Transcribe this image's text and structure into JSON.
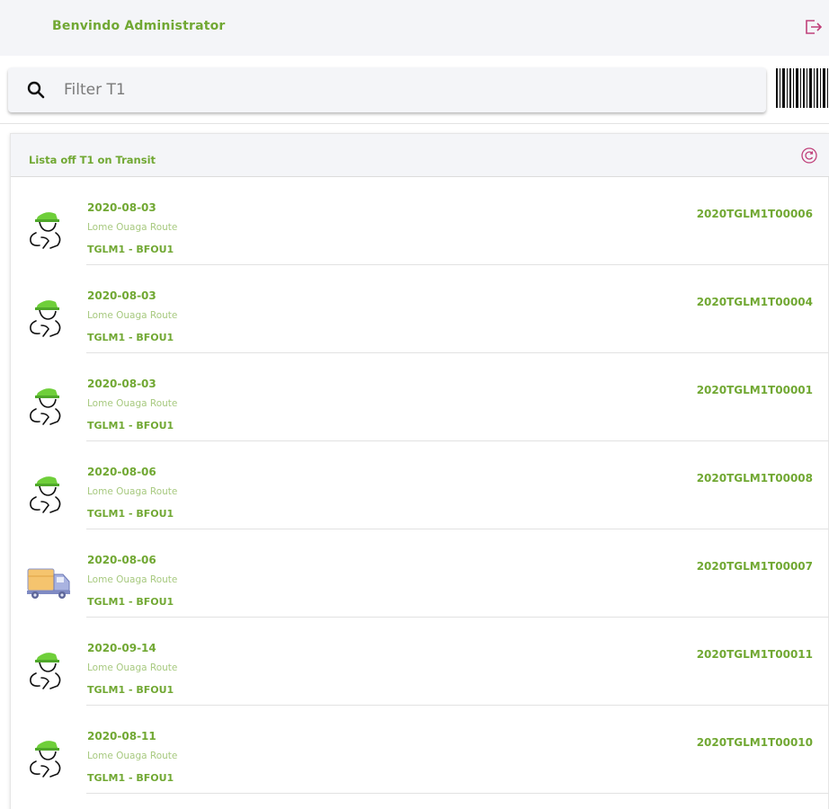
{
  "header": {
    "welcome": "Benvindo Administrator",
    "logout_icon": "logout-icon"
  },
  "search": {
    "placeholder": "Filter T1",
    "value": "",
    "icon": "search-icon",
    "scanner_icon": "barcode-icon"
  },
  "list": {
    "title": "Lista off T1 on Transit",
    "refresh_icon": "refresh-icon",
    "items": [
      {
        "date": "2020-08-03",
        "route": "Lome Ouaga Route",
        "code": "TGLM1 - BFOU1",
        "ref": "2020TGLM1T00006",
        "icon": "driver-icon"
      },
      {
        "date": "2020-08-03",
        "route": "Lome Ouaga Route",
        "code": "TGLM1 - BFOU1",
        "ref": "2020TGLM1T00004",
        "icon": "driver-icon"
      },
      {
        "date": "2020-08-03",
        "route": "Lome Ouaga Route",
        "code": "TGLM1 - BFOU1",
        "ref": "2020TGLM1T00001",
        "icon": "driver-icon"
      },
      {
        "date": "2020-08-06",
        "route": "Lome Ouaga Route",
        "code": "TGLM1 - BFOU1",
        "ref": "2020TGLM1T00008",
        "icon": "driver-icon"
      },
      {
        "date": "2020-08-06",
        "route": "Lome Ouaga Route",
        "code": "TGLM1 - BFOU1",
        "ref": "2020TGLM1T00007",
        "icon": "truck-icon"
      },
      {
        "date": "2020-09-14",
        "route": "Lome Ouaga Route",
        "code": "TGLM1 - BFOU1",
        "ref": "2020TGLM1T00011",
        "icon": "driver-icon"
      },
      {
        "date": "2020-08-11",
        "route": "Lome Ouaga Route",
        "code": "TGLM1 - BFOU1",
        "ref": "2020TGLM1T00010",
        "icon": "driver-icon"
      }
    ]
  },
  "colors": {
    "accent": "#71a833",
    "accent_light": "#a7c97f",
    "header_bg": "#f4f5f8",
    "icon_pink": "#c0407a"
  }
}
